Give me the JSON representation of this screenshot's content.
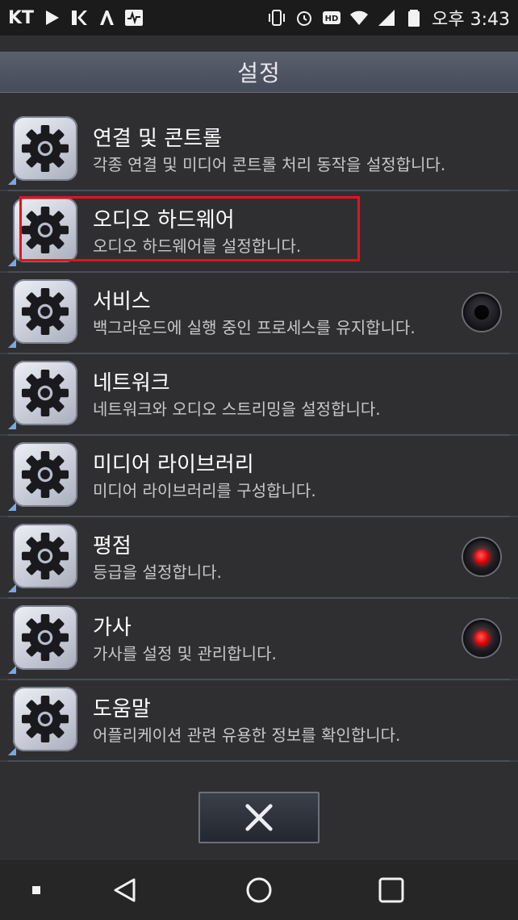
{
  "status_bar": {
    "carrier": "KT",
    "time": "오후 3:43",
    "icons": [
      "play-icon",
      "app-k-icon",
      "app-lambda-icon",
      "activity-icon",
      "vibrate-icon",
      "alarm-icon",
      "hd-icon",
      "wifi-icon",
      "signal-icon",
      "battery-icon"
    ]
  },
  "header": {
    "title": "설정"
  },
  "items": [
    {
      "title": "연결 및 콘트롤",
      "subtitle": "각종 연결 및 미디어 콘트롤 처리 동작을 설정합니다.",
      "toggle": "none"
    },
    {
      "title": "오디오 하드웨어",
      "subtitle": "오디오 하드웨어를 설정합니다.",
      "toggle": "none"
    },
    {
      "title": "서비스",
      "subtitle": "백그라운드에 실행 중인 프로세스를 유지합니다.",
      "toggle": "off"
    },
    {
      "title": "네트워크",
      "subtitle": "네트워크와 오디오 스트리밍을 설정합니다.",
      "toggle": "none"
    },
    {
      "title": "미디어 라이브러리",
      "subtitle": "미디어 라이브러리를 구성합니다.",
      "toggle": "none"
    },
    {
      "title": "평점",
      "subtitle": "등급을 설정합니다.",
      "toggle": "on"
    },
    {
      "title": "가사",
      "subtitle": "가사를 설정 및 관리합니다.",
      "toggle": "on"
    },
    {
      "title": "도움말",
      "subtitle": "어플리케이션 관련 유용한 정보를 확인합니다.",
      "toggle": "none"
    }
  ],
  "colors": {
    "highlight": "#e0141e",
    "toggle_on": "#e00000",
    "accent_corner": "#7aa7e0"
  }
}
